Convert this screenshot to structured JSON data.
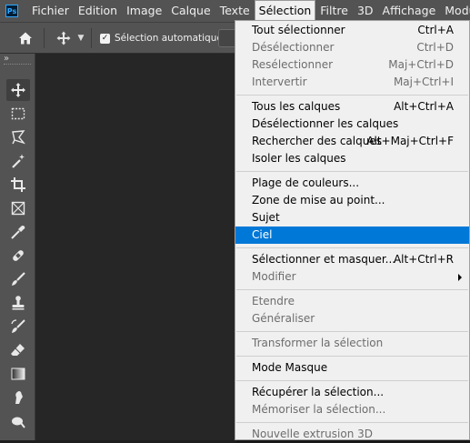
{
  "menubar": {
    "app_logo": "Ps",
    "items": [
      {
        "label": "Fichier"
      },
      {
        "label": "Edition"
      },
      {
        "label": "Image"
      },
      {
        "label": "Calque"
      },
      {
        "label": "Texte"
      },
      {
        "label": "Sélection",
        "active": true
      },
      {
        "label": "Filtre"
      },
      {
        "label": "3D"
      },
      {
        "label": "Affichage"
      },
      {
        "label": "Modules exte"
      }
    ]
  },
  "options_bar": {
    "auto_select_label": "Sélection automatique :",
    "auto_select_checked": true
  },
  "toolbar": {
    "collapse_glyph": "»",
    "tools": [
      {
        "name": "move-tool-icon",
        "selected": true
      },
      {
        "name": "rectangular-marquee-tool-icon"
      },
      {
        "name": "lasso-tool-icon"
      },
      {
        "name": "magic-wand-tool-icon"
      },
      {
        "name": "crop-tool-icon"
      },
      {
        "name": "frame-tool-icon"
      },
      {
        "name": "eyedropper-tool-icon"
      },
      {
        "name": "healing-brush-tool-icon"
      },
      {
        "name": "brush-tool-icon"
      },
      {
        "name": "clone-stamp-tool-icon"
      },
      {
        "name": "history-brush-tool-icon"
      },
      {
        "name": "eraser-tool-icon"
      },
      {
        "name": "gradient-tool-icon"
      },
      {
        "name": "smudge-tool-icon"
      },
      {
        "name": "dodge-tool-icon"
      }
    ]
  },
  "selection_menu": {
    "items": [
      {
        "label": "Tout sélectionner",
        "shortcut": "Ctrl+A",
        "disabled": false
      },
      {
        "label": "Désélectionner",
        "shortcut": "Ctrl+D",
        "disabled": true
      },
      {
        "label": "Resélectionner",
        "shortcut": "Maj+Ctrl+D",
        "disabled": true
      },
      {
        "label": "Intervertir",
        "shortcut": "Maj+Ctrl+I",
        "disabled": true
      },
      {
        "label": "Tous les calques",
        "shortcut": "Alt+Ctrl+A",
        "disabled": false
      },
      {
        "label": "Désélectionner les calques",
        "shortcut": "",
        "disabled": false
      },
      {
        "label": "Rechercher des calques",
        "shortcut": "Alt+Maj+Ctrl+F",
        "disabled": false
      },
      {
        "label": "Isoler les calques",
        "shortcut": "",
        "disabled": false
      },
      {
        "label": "Plage de couleurs...",
        "shortcut": "",
        "disabled": false
      },
      {
        "label": "Zone de mise au point...",
        "shortcut": "",
        "disabled": false
      },
      {
        "label": "Sujet",
        "shortcut": "",
        "disabled": false
      },
      {
        "label": "Ciel",
        "shortcut": "",
        "disabled": false,
        "highlighted": true
      },
      {
        "label": "Sélectionner et masquer...",
        "shortcut": "Alt+Ctrl+R",
        "disabled": false
      },
      {
        "label": "Modifier",
        "shortcut": "",
        "disabled": true,
        "submenu": true
      },
      {
        "label": "Etendre",
        "shortcut": "",
        "disabled": true
      },
      {
        "label": "Généraliser",
        "shortcut": "",
        "disabled": true
      },
      {
        "label": "Transformer la sélection",
        "shortcut": "",
        "disabled": true
      },
      {
        "label": "Mode Masque",
        "shortcut": "",
        "disabled": false
      },
      {
        "label": "Récupérer la sélection...",
        "shortcut": "",
        "disabled": false
      },
      {
        "label": "Mémoriser la sélection...",
        "shortcut": "",
        "disabled": true
      },
      {
        "label": "Nouvelle extrusion 3D",
        "shortcut": "",
        "disabled": true
      }
    ]
  },
  "colors": {
    "menu_highlight": "#0078d7",
    "panel_bg": "#535353",
    "canvas_bg": "#262626"
  }
}
